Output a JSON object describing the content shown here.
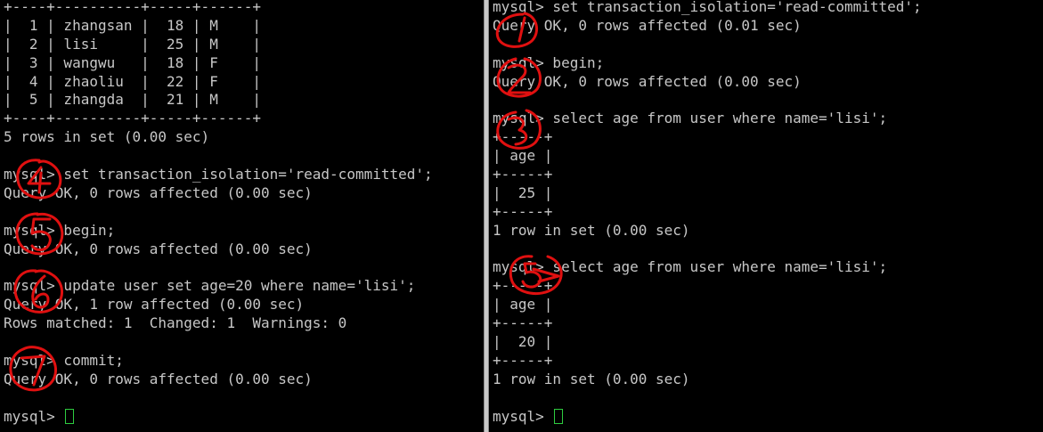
{
  "left_terminal": {
    "lines": [
      "+----+----------+-----+------+",
      "|  1 | zhangsan |  18 | M    |",
      "|  2 | lisi     |  25 | M    |",
      "|  3 | wangwu   |  18 | F    |",
      "|  4 | zhaoliu  |  22 | F    |",
      "|  5 | zhangda  |  21 | M    |",
      "+----+----------+-----+------+",
      "5 rows in set (0.00 sec)",
      "",
      "mysql> set transaction_isolation='read-committed';",
      "Query OK, 0 rows affected (0.00 sec)",
      "",
      "mysql> begin;",
      "Query OK, 0 rows affected (0.00 sec)",
      "",
      "mysql> update user set age=20 where name='lisi';",
      "Query OK, 1 row affected (0.00 sec)",
      "Rows matched: 1  Changed: 1  Warnings: 0",
      "",
      "mysql> commit;",
      "Query OK, 0 rows affected (0.00 sec)",
      "",
      "mysql> "
    ],
    "step_annotations": [
      "4",
      "5",
      "6",
      "7"
    ]
  },
  "right_terminal": {
    "lines": [
      "mysql> set transaction_isolation='read-committed';",
      "Query OK, 0 rows affected (0.01 sec)",
      "",
      "mysql> begin;",
      "Query OK, 0 rows affected (0.00 sec)",
      "",
      "mysql> select age from user where name='lisi';",
      "+-----+",
      "| age |",
      "+-----+",
      "|  25 |",
      "+-----+",
      "1 row in set (0.00 sec)",
      "",
      "mysql> select age from user where name='lisi';",
      "+-----+",
      "| age |",
      "+-----+",
      "|  20 |",
      "+-----+",
      "1 row in set (0.00 sec)",
      "",
      "mysql> "
    ],
    "step_annotations": [
      "1",
      "2",
      "3",
      "8"
    ]
  },
  "colors": {
    "background": "#000000",
    "text": "#c7c7c7",
    "cursor": "#2ecc40",
    "annotation": "#e01010",
    "divider": "#c9c9c9"
  }
}
